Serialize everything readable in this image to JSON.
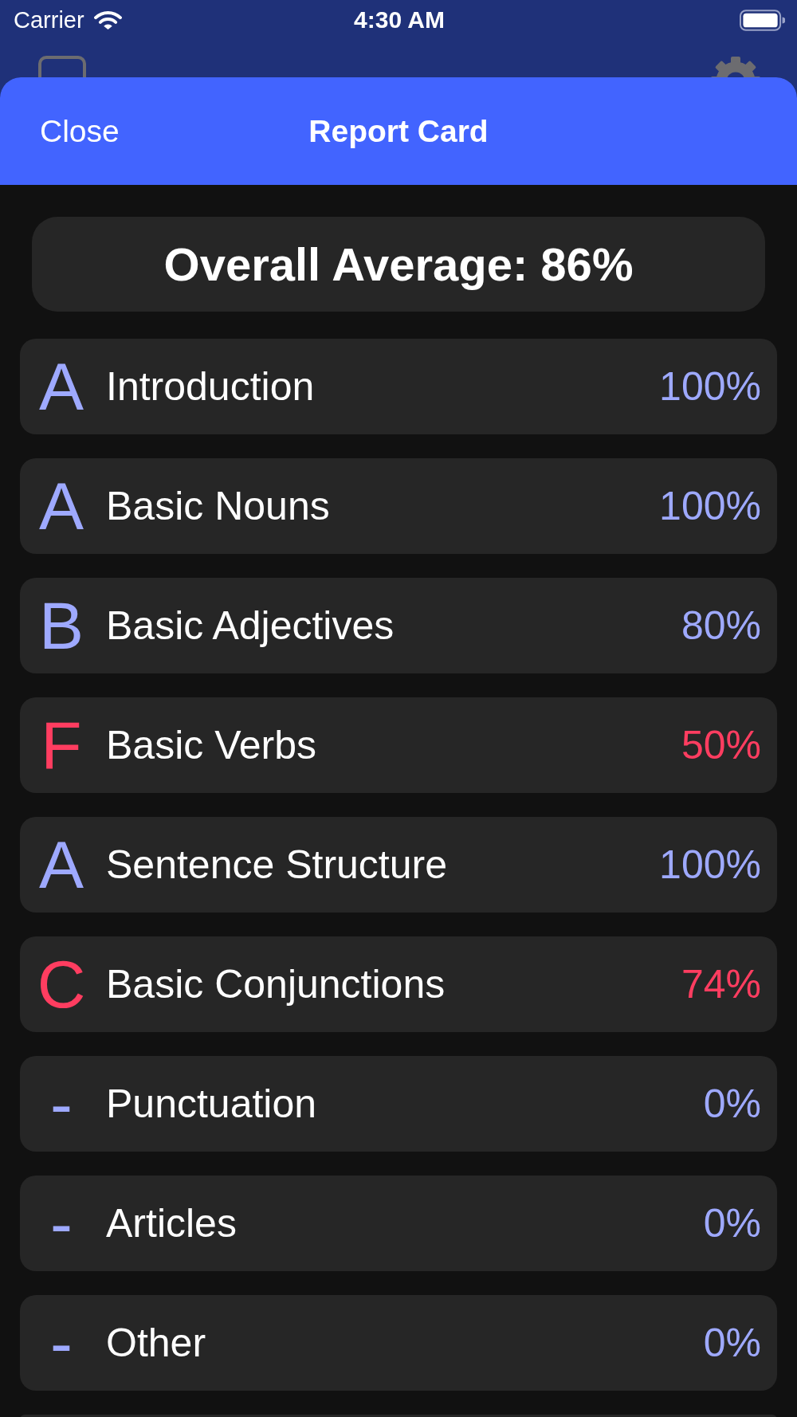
{
  "status_bar": {
    "carrier": "Carrier",
    "time": "4:30 AM"
  },
  "sheet": {
    "close_button": "Close",
    "title": "Report Card"
  },
  "overall": "Overall Average: 86%",
  "chapters": [
    {
      "grade": "A",
      "name": "Introduction",
      "score": "100%",
      "color": "#9ea9ff"
    },
    {
      "grade": "A",
      "name": "Basic Nouns",
      "score": "100%",
      "color": "#9ea9ff"
    },
    {
      "grade": "B",
      "name": "Basic Adjectives",
      "score": "80%",
      "color": "#9ea9ff"
    },
    {
      "grade": "F",
      "name": "Basic Verbs",
      "score": "50%",
      "color": "#ff3d60"
    },
    {
      "grade": "A",
      "name": "Sentence Structure",
      "score": "100%",
      "color": "#9ea9ff"
    },
    {
      "grade": "C",
      "name": "Basic Conjunctions",
      "score": "74%",
      "color": "#ff3d60"
    },
    {
      "grade": "-",
      "name": "Punctuation",
      "score": "0%",
      "color": "#9ea9ff"
    },
    {
      "grade": "-",
      "name": "Articles",
      "score": "0%",
      "color": "#9ea9ff"
    },
    {
      "grade": "-",
      "name": "Other",
      "score": "0%",
      "color": "#9ea9ff"
    }
  ]
}
